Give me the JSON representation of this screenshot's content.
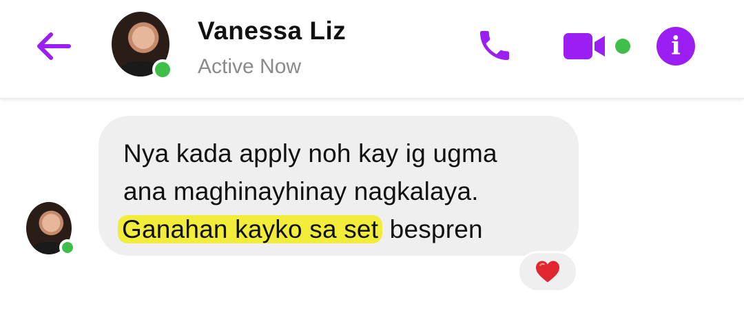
{
  "header": {
    "contact_name": "Vanessa Liz",
    "status": "Active Now",
    "icons": {
      "back": "arrow-left-icon",
      "call": "phone-icon",
      "video": "video-camera-icon",
      "info": "info-icon"
    },
    "accent_color": "#9b1ff2",
    "online_color": "#3fbf4a"
  },
  "conversation": {
    "message": {
      "line1": "Nya kada apply noh kay ig ugma",
      "line2": "ana maghinayhinay nagkalaya.",
      "line3_highlighted": "Ganahan kayko sa set",
      "line3_rest": " bespren",
      "highlight_color": "#f2ec3a",
      "bubble_color": "#efefef"
    },
    "reaction": {
      "emoji": "❤️",
      "icon": "heart-icon"
    }
  },
  "info_glyph": "i"
}
